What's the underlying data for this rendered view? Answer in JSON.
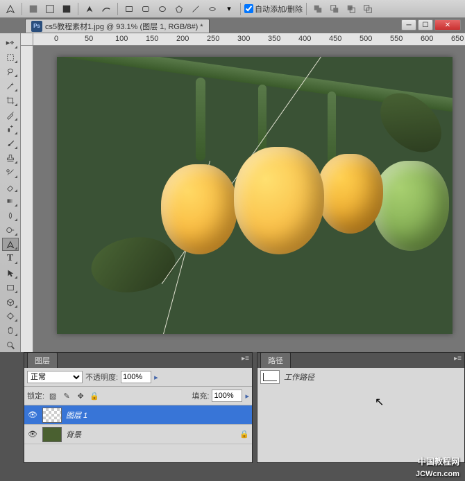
{
  "toolbar": {
    "auto_add_delete": "自动添加/删除"
  },
  "document": {
    "title": "cs5教程素材1.jpg @ 93.1% (图层 1, RGB/8#) *"
  },
  "ruler_marks": [
    "0",
    "50",
    "100",
    "150",
    "200",
    "250",
    "300",
    "350",
    "400",
    "450",
    "500",
    "550",
    "600",
    "650"
  ],
  "layers_panel": {
    "tab": "图层",
    "blend_mode": "正常",
    "opacity_label": "不透明度:",
    "opacity_value": "100%",
    "lock_label": "锁定:",
    "fill_label": "填充:",
    "fill_value": "100%",
    "layers": [
      {
        "name": "图层 1",
        "selected": true,
        "thumb": "checker"
      },
      {
        "name": "背景",
        "selected": false,
        "locked": true,
        "thumb": "img"
      }
    ]
  },
  "paths_panel": {
    "tab": "路径",
    "items": [
      {
        "name": "工作路径"
      }
    ]
  },
  "watermark": {
    "cn": "中国教程网",
    "en": "JCWcn.com"
  }
}
